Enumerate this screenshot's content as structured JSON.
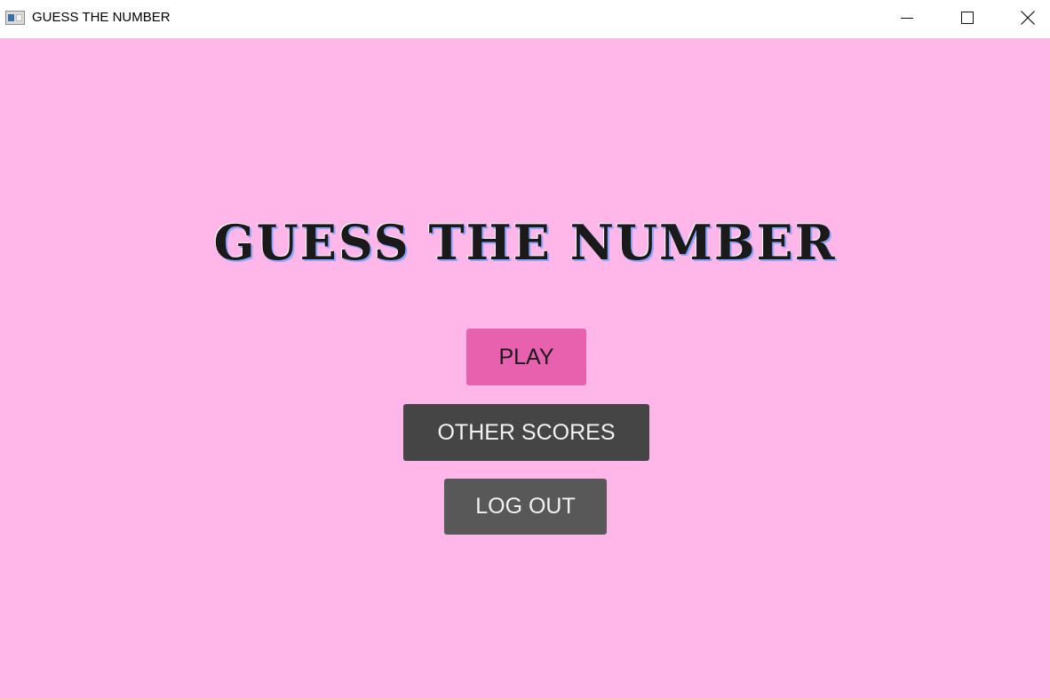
{
  "window": {
    "title": "GUESS THE NUMBER",
    "icon": "app-window-icon",
    "controls": {
      "minimize_icon": "minimize-icon",
      "maximize_icon": "maximize-icon",
      "close_icon": "close-icon"
    }
  },
  "main": {
    "heading": "GUESS THE NUMBER",
    "background_color": "#ffb6e8",
    "buttons": {
      "play": {
        "label": "PLAY",
        "color": "#e861ae"
      },
      "other_scores": {
        "label": "OTHER SCORES",
        "color": "#454545"
      },
      "log_out": {
        "label": "LOG OUT",
        "color": "#585858"
      }
    }
  }
}
